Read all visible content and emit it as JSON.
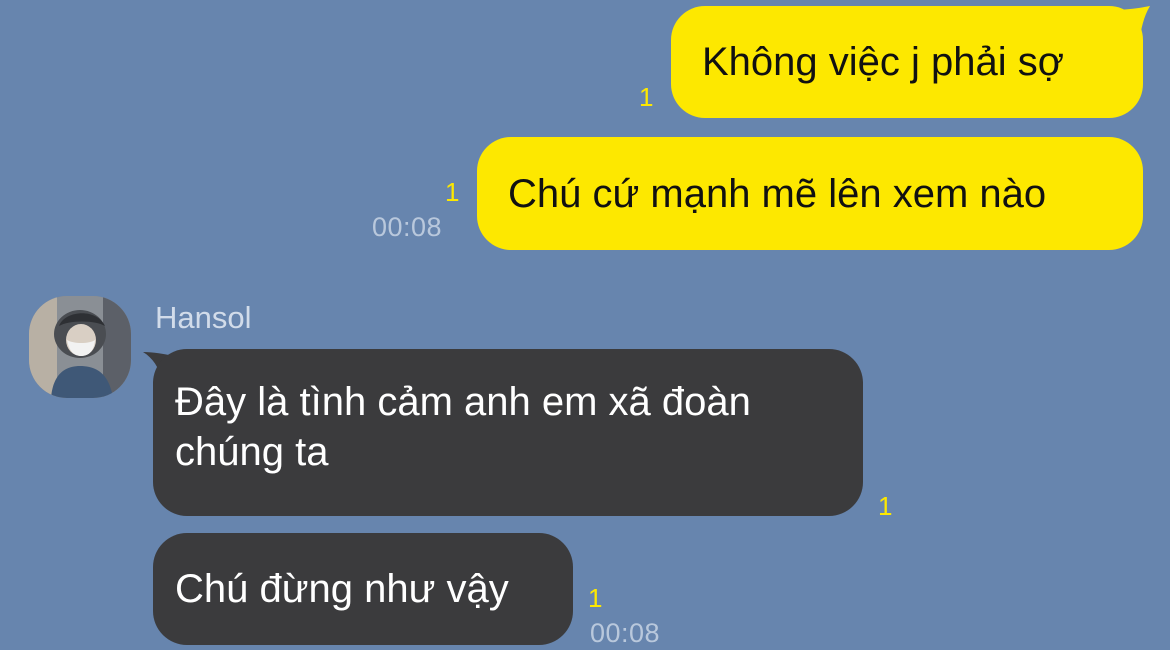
{
  "messages": {
    "out1": {
      "text": "Không việc j phải sợ",
      "unread": "1"
    },
    "out2": {
      "text": "Chú cứ mạnh mẽ lên xem nào",
      "unread": "1",
      "time": "00:08"
    },
    "in1": {
      "text": "Đây là tình cảm anh em xã đoàn chúng ta",
      "unread": "1"
    },
    "in2": {
      "text": "Chú đừng như vậy",
      "unread": "1",
      "time": "00:08"
    }
  },
  "sender": {
    "name": "Hansol"
  },
  "colors": {
    "background": "#6785ae",
    "outgoing_bubble": "#fde800",
    "incoming_bubble": "#3b3b3d",
    "unread_count": "#fde800",
    "timestamp": "#b9c8dc"
  }
}
